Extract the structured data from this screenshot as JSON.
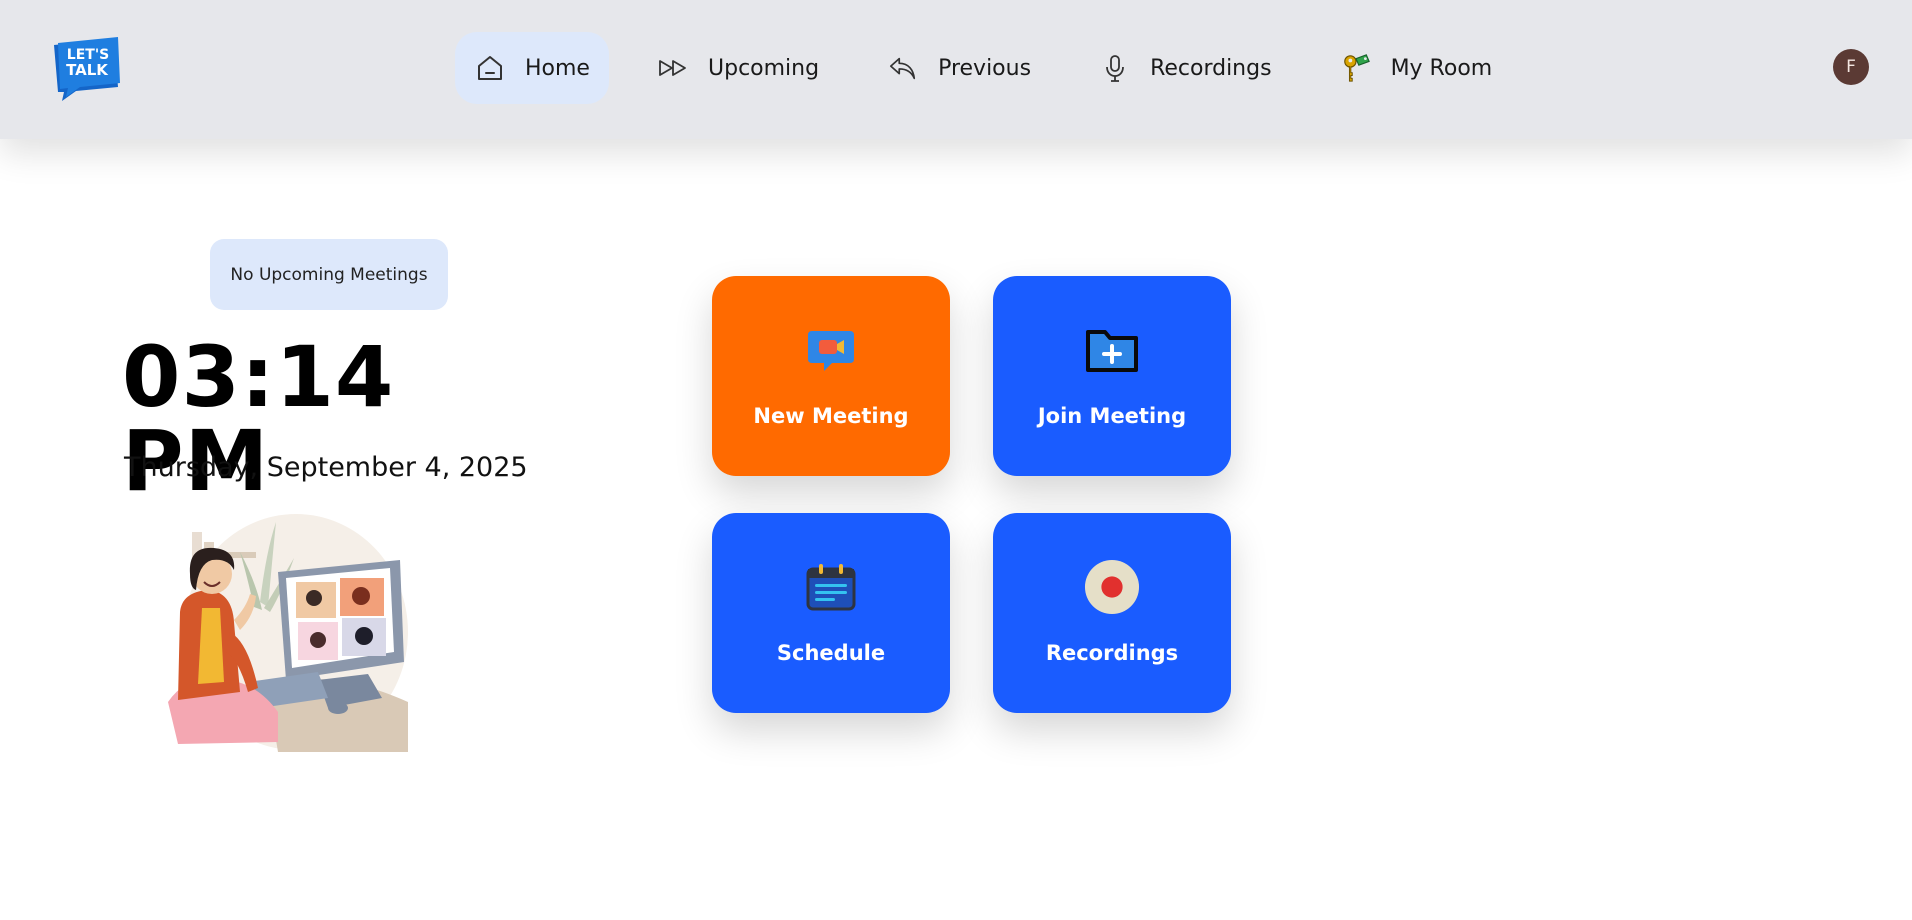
{
  "logo": {
    "text_line1": "LET'S",
    "text_line2": "TALK"
  },
  "nav": {
    "items": [
      {
        "label": "Home",
        "icon": "home-icon",
        "active": true
      },
      {
        "label": "Upcoming",
        "icon": "fast-forward-icon"
      },
      {
        "label": "Previous",
        "icon": "reply-arrow-icon"
      },
      {
        "label": "Recordings",
        "icon": "microphone-icon"
      },
      {
        "label": "My Room",
        "icon": "keys-icon"
      }
    ]
  },
  "user": {
    "avatar_initial": "F"
  },
  "upcoming_status": "No Upcoming Meetings",
  "clock": {
    "time": "03:14 PM",
    "date": "Thursday, September 4, 2025"
  },
  "actions": [
    {
      "label": "New Meeting",
      "icon": "video-chat-icon",
      "color": "#ff6a00"
    },
    {
      "label": "Join Meeting",
      "icon": "folder-plus-icon",
      "color": "#1a5cff"
    },
    {
      "label": "Schedule",
      "icon": "calendar-icon",
      "color": "#1a5cff"
    },
    {
      "label": "Recordings",
      "icon": "record-icon",
      "color": "#1a5cff"
    }
  ],
  "colors": {
    "topbar": "#e6e7eb",
    "active_nav": "#dde8fb",
    "accent_orange": "#ff6a00",
    "accent_blue": "#1a5cff"
  }
}
